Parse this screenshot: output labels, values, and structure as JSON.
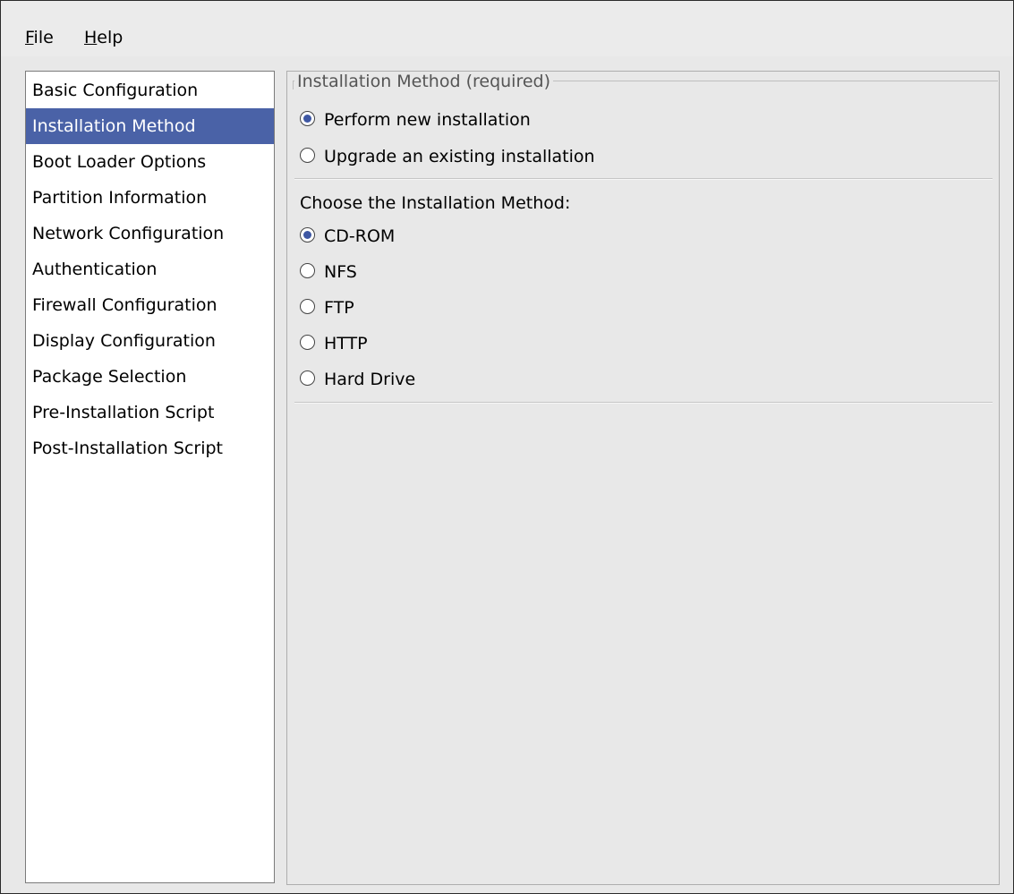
{
  "menu": {
    "file": {
      "mnemonic": "F",
      "rest": "ile"
    },
    "help": {
      "mnemonic": "H",
      "rest": "elp"
    }
  },
  "sidebar": {
    "items": [
      {
        "label": "Basic Configuration"
      },
      {
        "label": "Installation Method"
      },
      {
        "label": "Boot Loader Options"
      },
      {
        "label": "Partition Information"
      },
      {
        "label": "Network Configuration"
      },
      {
        "label": "Authentication"
      },
      {
        "label": "Firewall Configuration"
      },
      {
        "label": "Display Configuration"
      },
      {
        "label": "Package Selection"
      },
      {
        "label": "Pre-Installation Script"
      },
      {
        "label": "Post-Installation Script"
      }
    ],
    "selected": "Installation Method"
  },
  "content": {
    "frame_title": "Installation Method (required)",
    "install_type": {
      "options": [
        {
          "label": "Perform new installation",
          "checked": true
        },
        {
          "label": "Upgrade an existing installation",
          "checked": false
        }
      ]
    },
    "method_heading": "Choose the Installation Method:",
    "methods": {
      "options": [
        {
          "label": "CD-ROM",
          "checked": true
        },
        {
          "label": "NFS",
          "checked": false
        },
        {
          "label": "FTP",
          "checked": false
        },
        {
          "label": "HTTP",
          "checked": false
        },
        {
          "label": "Hard Drive",
          "checked": false
        }
      ]
    }
  },
  "colors": {
    "selection": "#4a62a7",
    "radio_dot": "#3e57a3",
    "background": "#e8e8e8"
  }
}
